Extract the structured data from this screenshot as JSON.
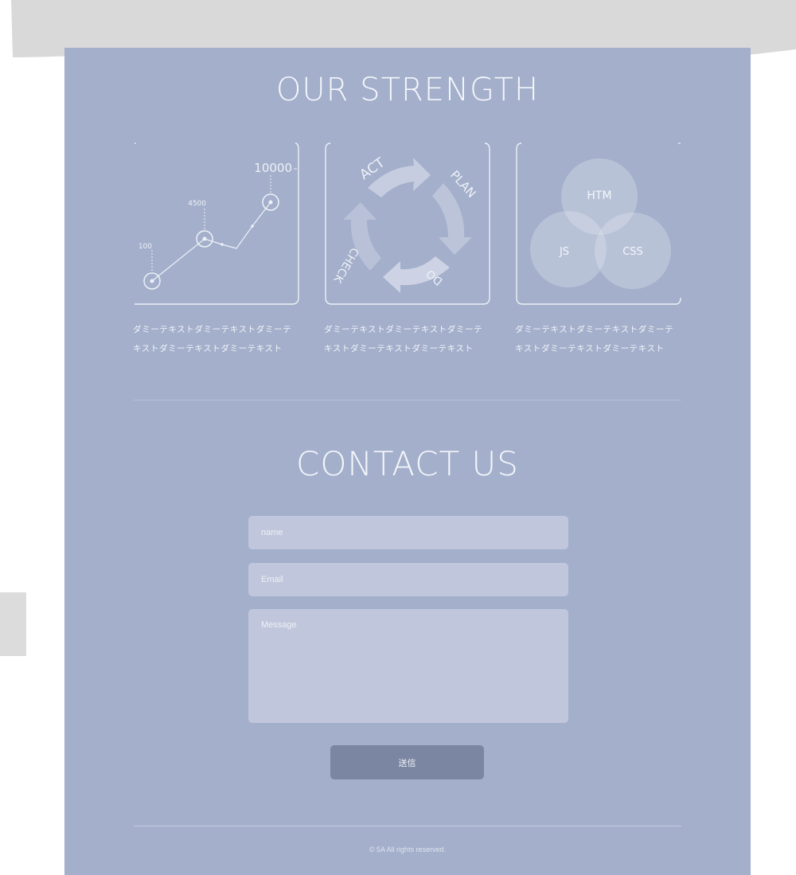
{
  "strength": {
    "title": "OUR STRENGTH",
    "chart_labels": [
      "10000",
      "4500",
      "100"
    ],
    "cycle_labels": [
      "ACT",
      "PLAN",
      "DO",
      "CHECK"
    ],
    "venn_labels": [
      "HTM",
      "JS",
      "CSS"
    ],
    "cards": [
      {
        "line1": "ダミーテキストダミーテキストダミーテ",
        "line2": "キストダミーテキストダミーテキスト"
      },
      {
        "line1": "ダミーテキストダミーテキストダミーテ",
        "line2": "キストダミーテキストダミーテキスト"
      },
      {
        "line1": "ダミーテキストダミーテキストダミーテ",
        "line2": "キストダミーテキストダミーテキスト"
      }
    ]
  },
  "contact": {
    "title": "CONTACT US",
    "name_placeholder": "name",
    "email_placeholder": "Email",
    "message_placeholder": "Message",
    "submit_label": "送信"
  },
  "footer": {
    "copyright": "© 5A All rights reserved."
  },
  "colors": {
    "panel_bg": "#a3afcb",
    "field_bg": "#c0c7dc",
    "button_bg": "#7b86a3",
    "top_band": "#d9d9d9"
  }
}
